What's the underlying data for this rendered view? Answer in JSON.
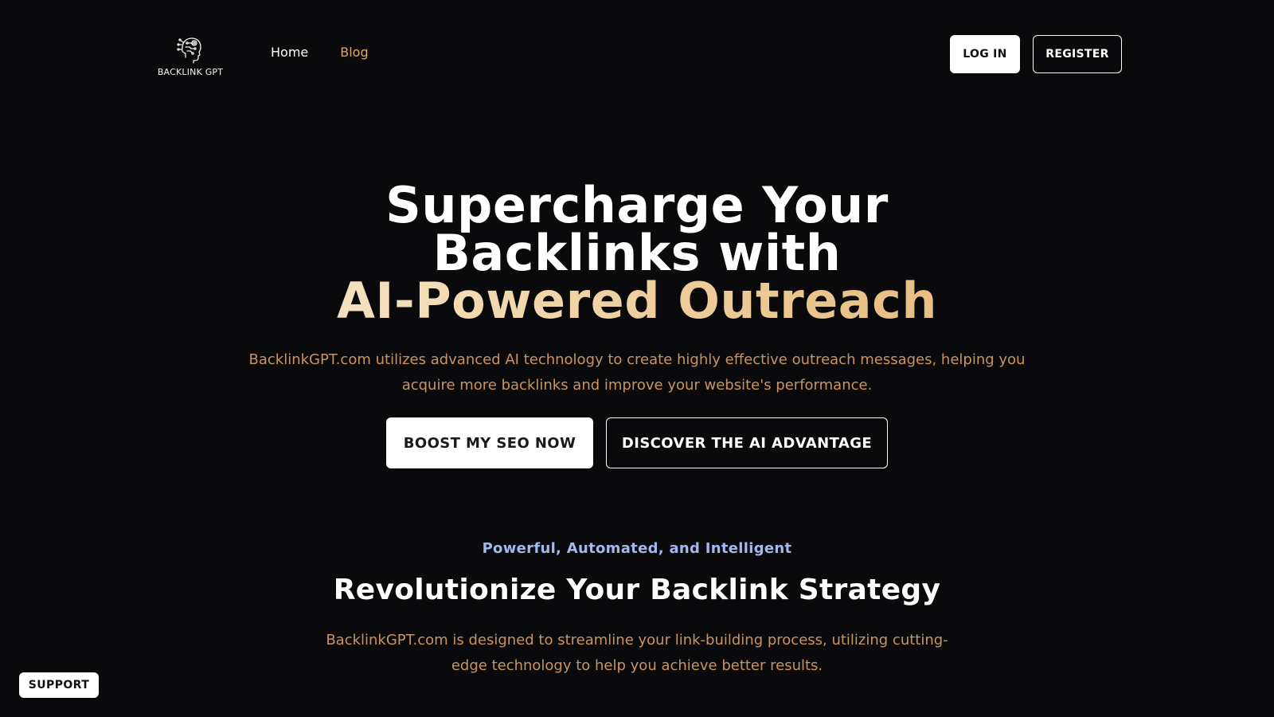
{
  "header": {
    "logo_text": "BACKLINK GPT",
    "nav": [
      {
        "label": "Home",
        "active": false
      },
      {
        "label": "Blog",
        "active": true
      }
    ],
    "login_label": "LOG IN",
    "register_label": "REGISTER"
  },
  "hero": {
    "title_line1": "Supercharge Your",
    "title_line2": "Backlinks with",
    "title_line3": "AI-Powered Outreach",
    "subtitle": "BacklinkGPT.com utilizes advanced AI technology to create highly effective outreach messages, helping you acquire more backlinks and improve your website's performance.",
    "primary_button": "BOOST MY SEO NOW",
    "secondary_button": "DISCOVER THE AI ADVANTAGE"
  },
  "features": {
    "eyebrow": "Powerful, Automated, and Intelligent",
    "title": "Revolutionize Your Backlink Strategy",
    "subtitle": "BacklinkGPT.com is designed to streamline your link-building process, utilizing cutting-edge technology to help you achieve better results."
  },
  "support_label": "SUPPORT",
  "colors": {
    "background": "#0a0a0c",
    "accent_gold": "#e0a862",
    "body_gold": "#c89460",
    "eyebrow_blue": "#a4b8f0"
  },
  "icons": {
    "logo": "robot-head-circuit-icon"
  }
}
